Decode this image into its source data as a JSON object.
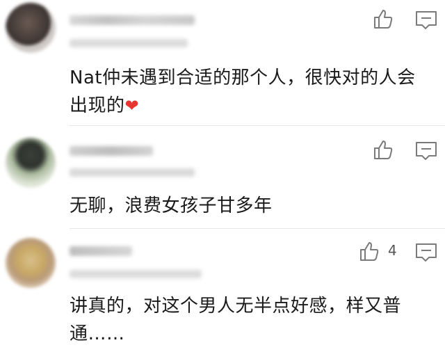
{
  "comments": [
    {
      "text": "Nat仲未遇到合适的那个人，很快对的人会出现的",
      "heart": "❤",
      "likes": "",
      "like_icon": "thumbs-up-icon",
      "reply_icon": "comment-icon"
    },
    {
      "text": "无聊，浪费女孩子甘多年",
      "likes": "",
      "like_icon": "thumbs-up-icon",
      "reply_icon": "comment-icon"
    },
    {
      "text": "讲真的，对这个男人无半点好感，样又普通……",
      "likes": "4",
      "like_icon": "thumbs-up-icon",
      "reply_icon": "comment-icon"
    }
  ],
  "colors": {
    "text": "#1a1a1a",
    "icon": "#7a7a7a",
    "heart": "#e8352f"
  }
}
